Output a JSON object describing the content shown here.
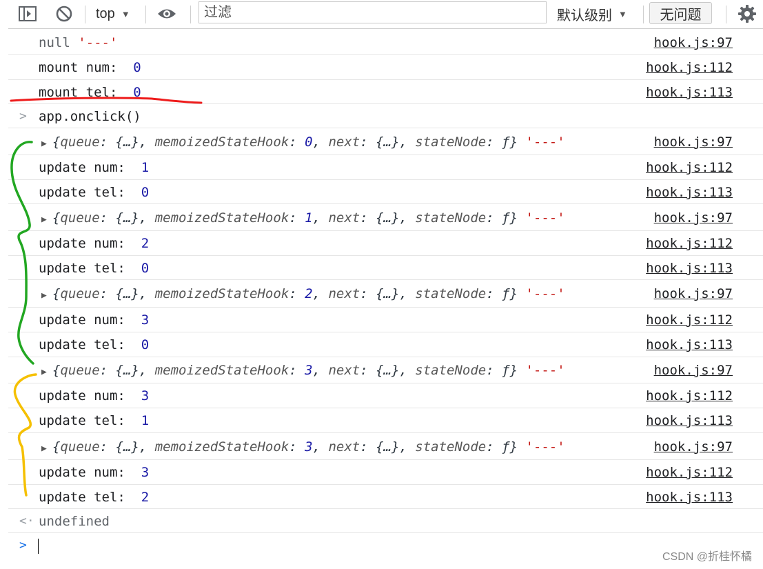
{
  "toolbar": {
    "context": "top",
    "filter_placeholder": "过滤",
    "level": "默认级别",
    "issues": "无问题",
    "icons": [
      "sidebar-toggle-icon",
      "clear-console-icon",
      "eye-icon",
      "gear-icon"
    ]
  },
  "rows": [
    {
      "parts": [
        {
          "t": "null",
          "c": "gray"
        },
        {
          "t": " ",
          "c": ""
        },
        {
          "t": "'---'",
          "c": "str"
        }
      ],
      "src": "hook.js:97"
    },
    {
      "parts": [
        {
          "t": "mount num:  ",
          "c": ""
        },
        {
          "t": "0",
          "c": "num"
        }
      ],
      "src": "hook.js:112"
    },
    {
      "parts": [
        {
          "t": "mount tel:  ",
          "c": ""
        },
        {
          "t": "0",
          "c": "num"
        }
      ],
      "src": "hook.js:113"
    },
    {
      "input": "app.onclick()"
    },
    {
      "obj": "0",
      "src": "hook.js:97"
    },
    {
      "parts": [
        {
          "t": "update num:  ",
          "c": ""
        },
        {
          "t": "1",
          "c": "num"
        }
      ],
      "src": "hook.js:112"
    },
    {
      "parts": [
        {
          "t": "update tel:  ",
          "c": ""
        },
        {
          "t": "0",
          "c": "num"
        }
      ],
      "src": "hook.js:113"
    },
    {
      "obj": "1",
      "src": "hook.js:97"
    },
    {
      "parts": [
        {
          "t": "update num:  ",
          "c": ""
        },
        {
          "t": "2",
          "c": "num"
        }
      ],
      "src": "hook.js:112"
    },
    {
      "parts": [
        {
          "t": "update tel:  ",
          "c": ""
        },
        {
          "t": "0",
          "c": "num"
        }
      ],
      "src": "hook.js:113"
    },
    {
      "obj": "2",
      "src": "hook.js:97"
    },
    {
      "parts": [
        {
          "t": "update num:  ",
          "c": ""
        },
        {
          "t": "3",
          "c": "num"
        }
      ],
      "src": "hook.js:112"
    },
    {
      "parts": [
        {
          "t": "update tel:  ",
          "c": ""
        },
        {
          "t": "0",
          "c": "num"
        }
      ],
      "src": "hook.js:113"
    },
    {
      "obj": "3",
      "src": "hook.js:97"
    },
    {
      "parts": [
        {
          "t": "update num:  ",
          "c": ""
        },
        {
          "t": "3",
          "c": "num"
        }
      ],
      "src": "hook.js:112"
    },
    {
      "parts": [
        {
          "t": "update tel:  ",
          "c": ""
        },
        {
          "t": "1",
          "c": "num"
        }
      ],
      "src": "hook.js:113"
    },
    {
      "obj": "3",
      "src": "hook.js:97"
    },
    {
      "parts": [
        {
          "t": "update num:  ",
          "c": ""
        },
        {
          "t": "3",
          "c": "num"
        }
      ],
      "src": "hook.js:112"
    },
    {
      "parts": [
        {
          "t": "update tel:  ",
          "c": ""
        },
        {
          "t": "2",
          "c": "num"
        }
      ],
      "src": "hook.js:113"
    },
    {
      "result": "undefined"
    }
  ],
  "watermark": "CSDN @折桂怀橘",
  "annotation_colors": {
    "underline": "#ee1c1c",
    "green_bracket": "#22a722",
    "yellow_bracket": "#f5c000"
  }
}
